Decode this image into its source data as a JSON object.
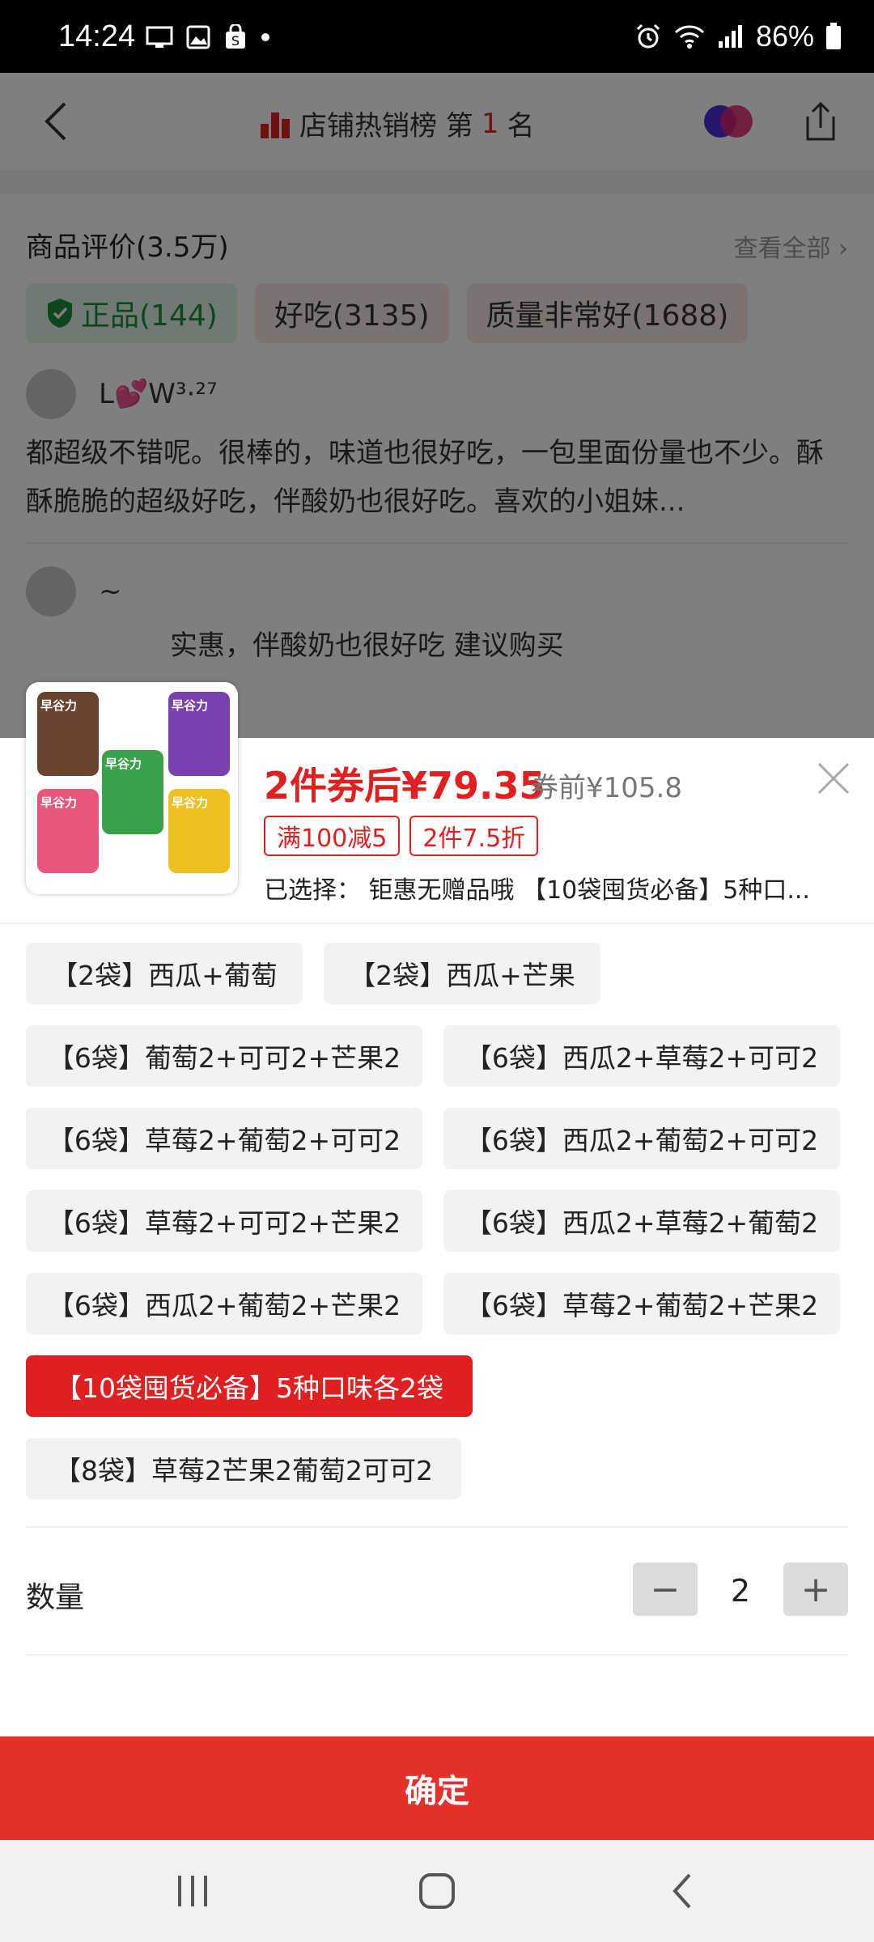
{
  "status_bar": {
    "time": "14:24",
    "battery": "86%"
  },
  "header": {
    "rank_text": "店铺热销榜 第",
    "rank_num": "1",
    "rank_suffix": "名"
  },
  "reviews": {
    "title": "商品评价(3.5万)",
    "view_all": "查看全部",
    "tags": [
      "正品(144)",
      "好吃(3135)",
      "质量非常好(1688)"
    ],
    "user1": "L💕W³·²⁷",
    "comment1": "都超级不错呢。很棒的，味道也很好吃，一包里面份量也不少。酥酥脆脆的超级好吃，伴酸奶也很好吃。喜欢的小姐妹...",
    "user2": "~",
    "comment2": "实惠，伴酸奶也很好吃 建议购买"
  },
  "product": {
    "price_after_coupon": "2件券后¥79.35",
    "price_before": "券前¥105.8",
    "promo_badges": [
      "满100减5",
      "2件7.5折"
    ],
    "selected": "已选择： 钜惠无赠品哦 【10袋囤货必备】5种口...",
    "brand_label": "早谷力"
  },
  "options": [
    "【2袋】西瓜+葡萄",
    "【2袋】西瓜+芒果",
    "【6袋】葡萄2+可可2+芒果2",
    "【6袋】西瓜2+草莓2+可可2",
    "【6袋】草莓2+葡萄2+可可2",
    "【6袋】西瓜2+葡萄2+可可2",
    "【6袋】草莓2+可可2+芒果2",
    "【6袋】西瓜2+草莓2+葡萄2",
    "【6袋】西瓜2+葡萄2+芒果2",
    "【6袋】草莓2+葡萄2+芒果2",
    "【10袋囤货必备】5种口味各2袋",
    "【8袋】草莓2芒果2葡萄2可可2"
  ],
  "selected_option_index": 10,
  "quantity": {
    "label": "数量",
    "value": "2",
    "minus": "−",
    "plus": "+"
  },
  "confirm_label": "确定",
  "colors": {
    "accent": "#e02020",
    "confirm_bg": "#e3302a"
  }
}
